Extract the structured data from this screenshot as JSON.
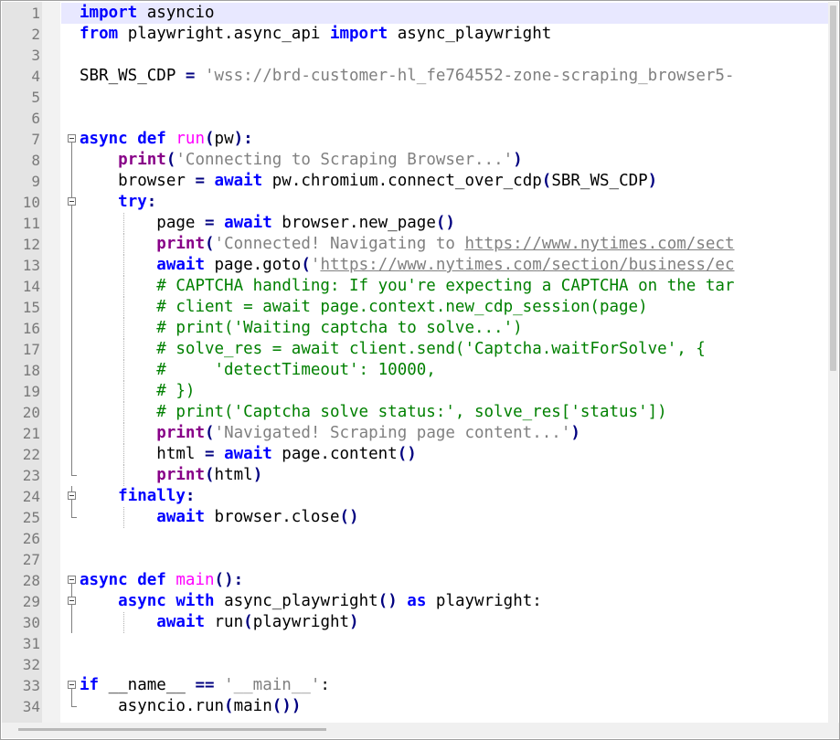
{
  "editor": {
    "lines": [
      {
        "n": "1",
        "tokens": [
          {
            "t": "import",
            "c": "kw"
          },
          {
            "t": " asyncio",
            "c": ""
          }
        ]
      },
      {
        "n": "2",
        "tokens": [
          {
            "t": "from",
            "c": "kw"
          },
          {
            "t": " playwright.async_api ",
            "c": ""
          },
          {
            "t": "import",
            "c": "kw"
          },
          {
            "t": " async_playwright",
            "c": ""
          }
        ]
      },
      {
        "n": "3",
        "tokens": []
      },
      {
        "n": "4",
        "tokens": [
          {
            "t": "SBR_WS_CDP ",
            "c": ""
          },
          {
            "t": "=",
            "c": "op"
          },
          {
            "t": " 'wss://brd-customer-hl_fe764552-zone-scraping_browser5-",
            "c": "str"
          }
        ]
      },
      {
        "n": "5",
        "tokens": []
      },
      {
        "n": "6",
        "tokens": []
      },
      {
        "n": "7",
        "tokens": [
          {
            "t": "async",
            "c": "kw"
          },
          {
            "t": " ",
            "c": ""
          },
          {
            "t": "def",
            "c": "kw"
          },
          {
            "t": " ",
            "c": ""
          },
          {
            "t": "run",
            "c": "fn"
          },
          {
            "t": "(",
            "c": "op"
          },
          {
            "t": "pw",
            "c": ""
          },
          {
            "t": "):",
            "c": "op"
          }
        ]
      },
      {
        "n": "8",
        "tokens": [
          {
            "t": "    ",
            "c": ""
          },
          {
            "t": "print",
            "c": "bi"
          },
          {
            "t": "(",
            "c": "op"
          },
          {
            "t": "'Connecting to Scraping Browser...'",
            "c": "str"
          },
          {
            "t": ")",
            "c": "op"
          }
        ]
      },
      {
        "n": "9",
        "tokens": [
          {
            "t": "    browser ",
            "c": ""
          },
          {
            "t": "=",
            "c": "op"
          },
          {
            "t": " ",
            "c": ""
          },
          {
            "t": "await",
            "c": "kw"
          },
          {
            "t": " pw.chromium.connect_over_cdp",
            "c": ""
          },
          {
            "t": "(",
            "c": "op"
          },
          {
            "t": "SBR_WS_CDP",
            "c": ""
          },
          {
            "t": ")",
            "c": "op"
          }
        ]
      },
      {
        "n": "10",
        "tokens": [
          {
            "t": "    ",
            "c": ""
          },
          {
            "t": "try",
            "c": "kw"
          },
          {
            "t": ":",
            "c": "op"
          }
        ]
      },
      {
        "n": "11",
        "tokens": [
          {
            "t": "        page ",
            "c": ""
          },
          {
            "t": "=",
            "c": "op"
          },
          {
            "t": " ",
            "c": ""
          },
          {
            "t": "await",
            "c": "kw"
          },
          {
            "t": " browser.new_page",
            "c": ""
          },
          {
            "t": "()",
            "c": "op"
          }
        ]
      },
      {
        "n": "12",
        "tokens": [
          {
            "t": "        ",
            "c": ""
          },
          {
            "t": "print",
            "c": "bi"
          },
          {
            "t": "(",
            "c": "op"
          },
          {
            "t": "'Connected! Navigating to ",
            "c": "str"
          },
          {
            "t": "https://www.nytimes.com/sect",
            "c": "url"
          }
        ]
      },
      {
        "n": "13",
        "tokens": [
          {
            "t": "        ",
            "c": ""
          },
          {
            "t": "await",
            "c": "kw"
          },
          {
            "t": " page.goto",
            "c": ""
          },
          {
            "t": "(",
            "c": "op"
          },
          {
            "t": "'",
            "c": "str"
          },
          {
            "t": "https://www.nytimes.com/section/business/ec",
            "c": "url"
          }
        ]
      },
      {
        "n": "14",
        "tokens": [
          {
            "t": "        ",
            "c": ""
          },
          {
            "t": "# CAPTCHA handling: If you're expecting a CAPTCHA on the tar",
            "c": "cm"
          }
        ]
      },
      {
        "n": "15",
        "tokens": [
          {
            "t": "        ",
            "c": ""
          },
          {
            "t": "# client = await page.context.new_cdp_session(page)",
            "c": "cm"
          }
        ]
      },
      {
        "n": "16",
        "tokens": [
          {
            "t": "        ",
            "c": ""
          },
          {
            "t": "# print('Waiting captcha to solve...')",
            "c": "cm"
          }
        ]
      },
      {
        "n": "17",
        "tokens": [
          {
            "t": "        ",
            "c": ""
          },
          {
            "t": "# solve_res = await client.send('Captcha.waitForSolve', {",
            "c": "cm"
          }
        ]
      },
      {
        "n": "18",
        "tokens": [
          {
            "t": "        ",
            "c": ""
          },
          {
            "t": "#     'detectTimeout': 10000,",
            "c": "cm"
          }
        ]
      },
      {
        "n": "19",
        "tokens": [
          {
            "t": "        ",
            "c": ""
          },
          {
            "t": "# })",
            "c": "cm"
          }
        ]
      },
      {
        "n": "20",
        "tokens": [
          {
            "t": "        ",
            "c": ""
          },
          {
            "t": "# print('Captcha solve status:', solve_res['status'])",
            "c": "cm"
          }
        ]
      },
      {
        "n": "21",
        "tokens": [
          {
            "t": "        ",
            "c": ""
          },
          {
            "t": "print",
            "c": "bi"
          },
          {
            "t": "(",
            "c": "op"
          },
          {
            "t": "'Navigated! Scraping page content...'",
            "c": "str"
          },
          {
            "t": ")",
            "c": "op"
          }
        ]
      },
      {
        "n": "22",
        "tokens": [
          {
            "t": "        html ",
            "c": ""
          },
          {
            "t": "=",
            "c": "op"
          },
          {
            "t": " ",
            "c": ""
          },
          {
            "t": "await",
            "c": "kw"
          },
          {
            "t": " page.content",
            "c": ""
          },
          {
            "t": "()",
            "c": "op"
          }
        ]
      },
      {
        "n": "23",
        "tokens": [
          {
            "t": "        ",
            "c": ""
          },
          {
            "t": "print",
            "c": "bi"
          },
          {
            "t": "(",
            "c": "op"
          },
          {
            "t": "html",
            "c": ""
          },
          {
            "t": ")",
            "c": "op"
          }
        ]
      },
      {
        "n": "24",
        "tokens": [
          {
            "t": "    ",
            "c": ""
          },
          {
            "t": "finally",
            "c": "kw"
          },
          {
            "t": ":",
            "c": "op"
          }
        ]
      },
      {
        "n": "25",
        "tokens": [
          {
            "t": "        ",
            "c": ""
          },
          {
            "t": "await",
            "c": "kw"
          },
          {
            "t": " browser.close",
            "c": ""
          },
          {
            "t": "()",
            "c": "op"
          }
        ]
      },
      {
        "n": "26",
        "tokens": []
      },
      {
        "n": "27",
        "tokens": []
      },
      {
        "n": "28",
        "tokens": [
          {
            "t": "async",
            "c": "kw"
          },
          {
            "t": " ",
            "c": ""
          },
          {
            "t": "def",
            "c": "kw"
          },
          {
            "t": " ",
            "c": ""
          },
          {
            "t": "main",
            "c": "fn"
          },
          {
            "t": "():",
            "c": "op"
          }
        ]
      },
      {
        "n": "29",
        "tokens": [
          {
            "t": "    ",
            "c": ""
          },
          {
            "t": "async",
            "c": "kw"
          },
          {
            "t": " ",
            "c": ""
          },
          {
            "t": "with",
            "c": "kw"
          },
          {
            "t": " async_playwright",
            "c": ""
          },
          {
            "t": "()",
            "c": "op"
          },
          {
            "t": " ",
            "c": ""
          },
          {
            "t": "as",
            "c": "kw"
          },
          {
            "t": " playwright:",
            "c": ""
          }
        ]
      },
      {
        "n": "30",
        "tokens": [
          {
            "t": "        ",
            "c": ""
          },
          {
            "t": "await",
            "c": "kw"
          },
          {
            "t": " run",
            "c": ""
          },
          {
            "t": "(",
            "c": "op"
          },
          {
            "t": "playwright",
            "c": ""
          },
          {
            "t": ")",
            "c": "op"
          }
        ]
      },
      {
        "n": "31",
        "tokens": []
      },
      {
        "n": "32",
        "tokens": []
      },
      {
        "n": "33",
        "tokens": [
          {
            "t": "if",
            "c": "kw"
          },
          {
            "t": " __name__ ",
            "c": ""
          },
          {
            "t": "==",
            "c": "op"
          },
          {
            "t": " ",
            "c": ""
          },
          {
            "t": "'__main__'",
            "c": "str"
          },
          {
            "t": ":",
            "c": ""
          }
        ]
      },
      {
        "n": "34",
        "tokens": [
          {
            "t": "    asyncio.run",
            "c": ""
          },
          {
            "t": "(",
            "c": "op"
          },
          {
            "t": "main",
            "c": ""
          },
          {
            "t": "())",
            "c": "op"
          }
        ]
      }
    ]
  }
}
